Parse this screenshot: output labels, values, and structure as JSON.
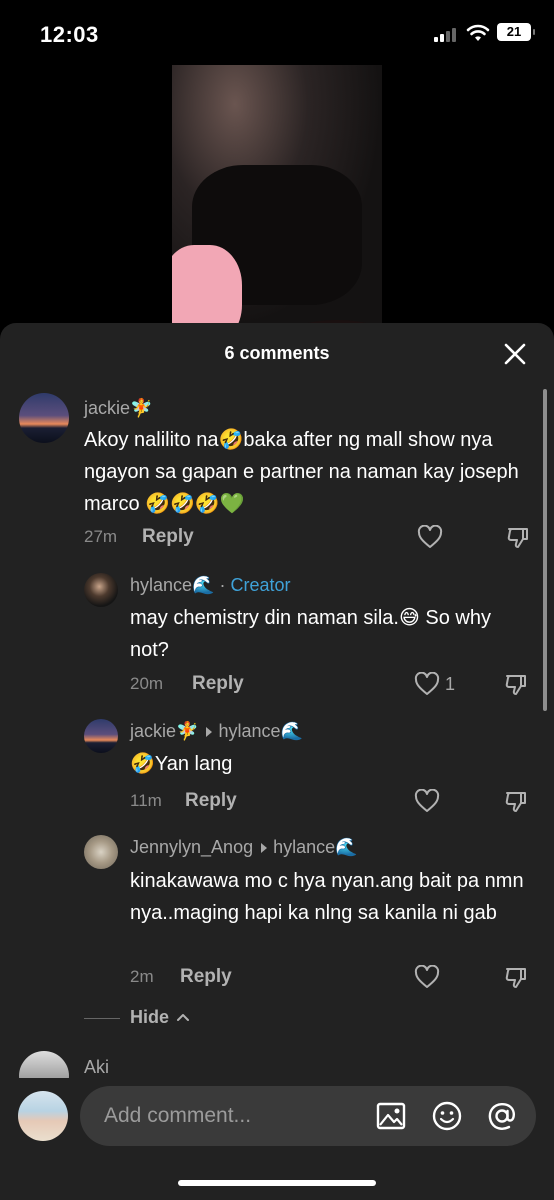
{
  "status": {
    "time": "12:03",
    "battery": "21"
  },
  "sheet": {
    "title": "6 comments"
  },
  "comments": [
    {
      "user": "jackie🧚",
      "text": "Akoy nalilito na🤣baka after ng mall show nya ngayon sa gapan e partner na naman kay joseph marco 🤣🤣🤣💚",
      "time": "27m",
      "reply": "Reply"
    },
    {
      "user": "hylance🌊",
      "creator_sep": " · ",
      "creator": "Creator",
      "text": "may chemistry din naman sila.😅 So why not?",
      "time": "20m",
      "reply": "Reply",
      "likes": "1"
    },
    {
      "user": "jackie🧚",
      "reply_to": "hylance🌊",
      "text": "🤣Yan lang",
      "time": "11m",
      "reply": "Reply"
    },
    {
      "user": "Jennylyn_Anog",
      "reply_to": "hylance🌊",
      "text": "kinakawawa mo c hya nyan.ang bait pa nmn nya..maging hapi ka nlng sa kanila ni gab",
      "time": "2m",
      "reply": "Reply"
    },
    {
      "user": "Aki"
    }
  ],
  "hide_label": "Hide",
  "input": {
    "placeholder": "Add comment..."
  }
}
